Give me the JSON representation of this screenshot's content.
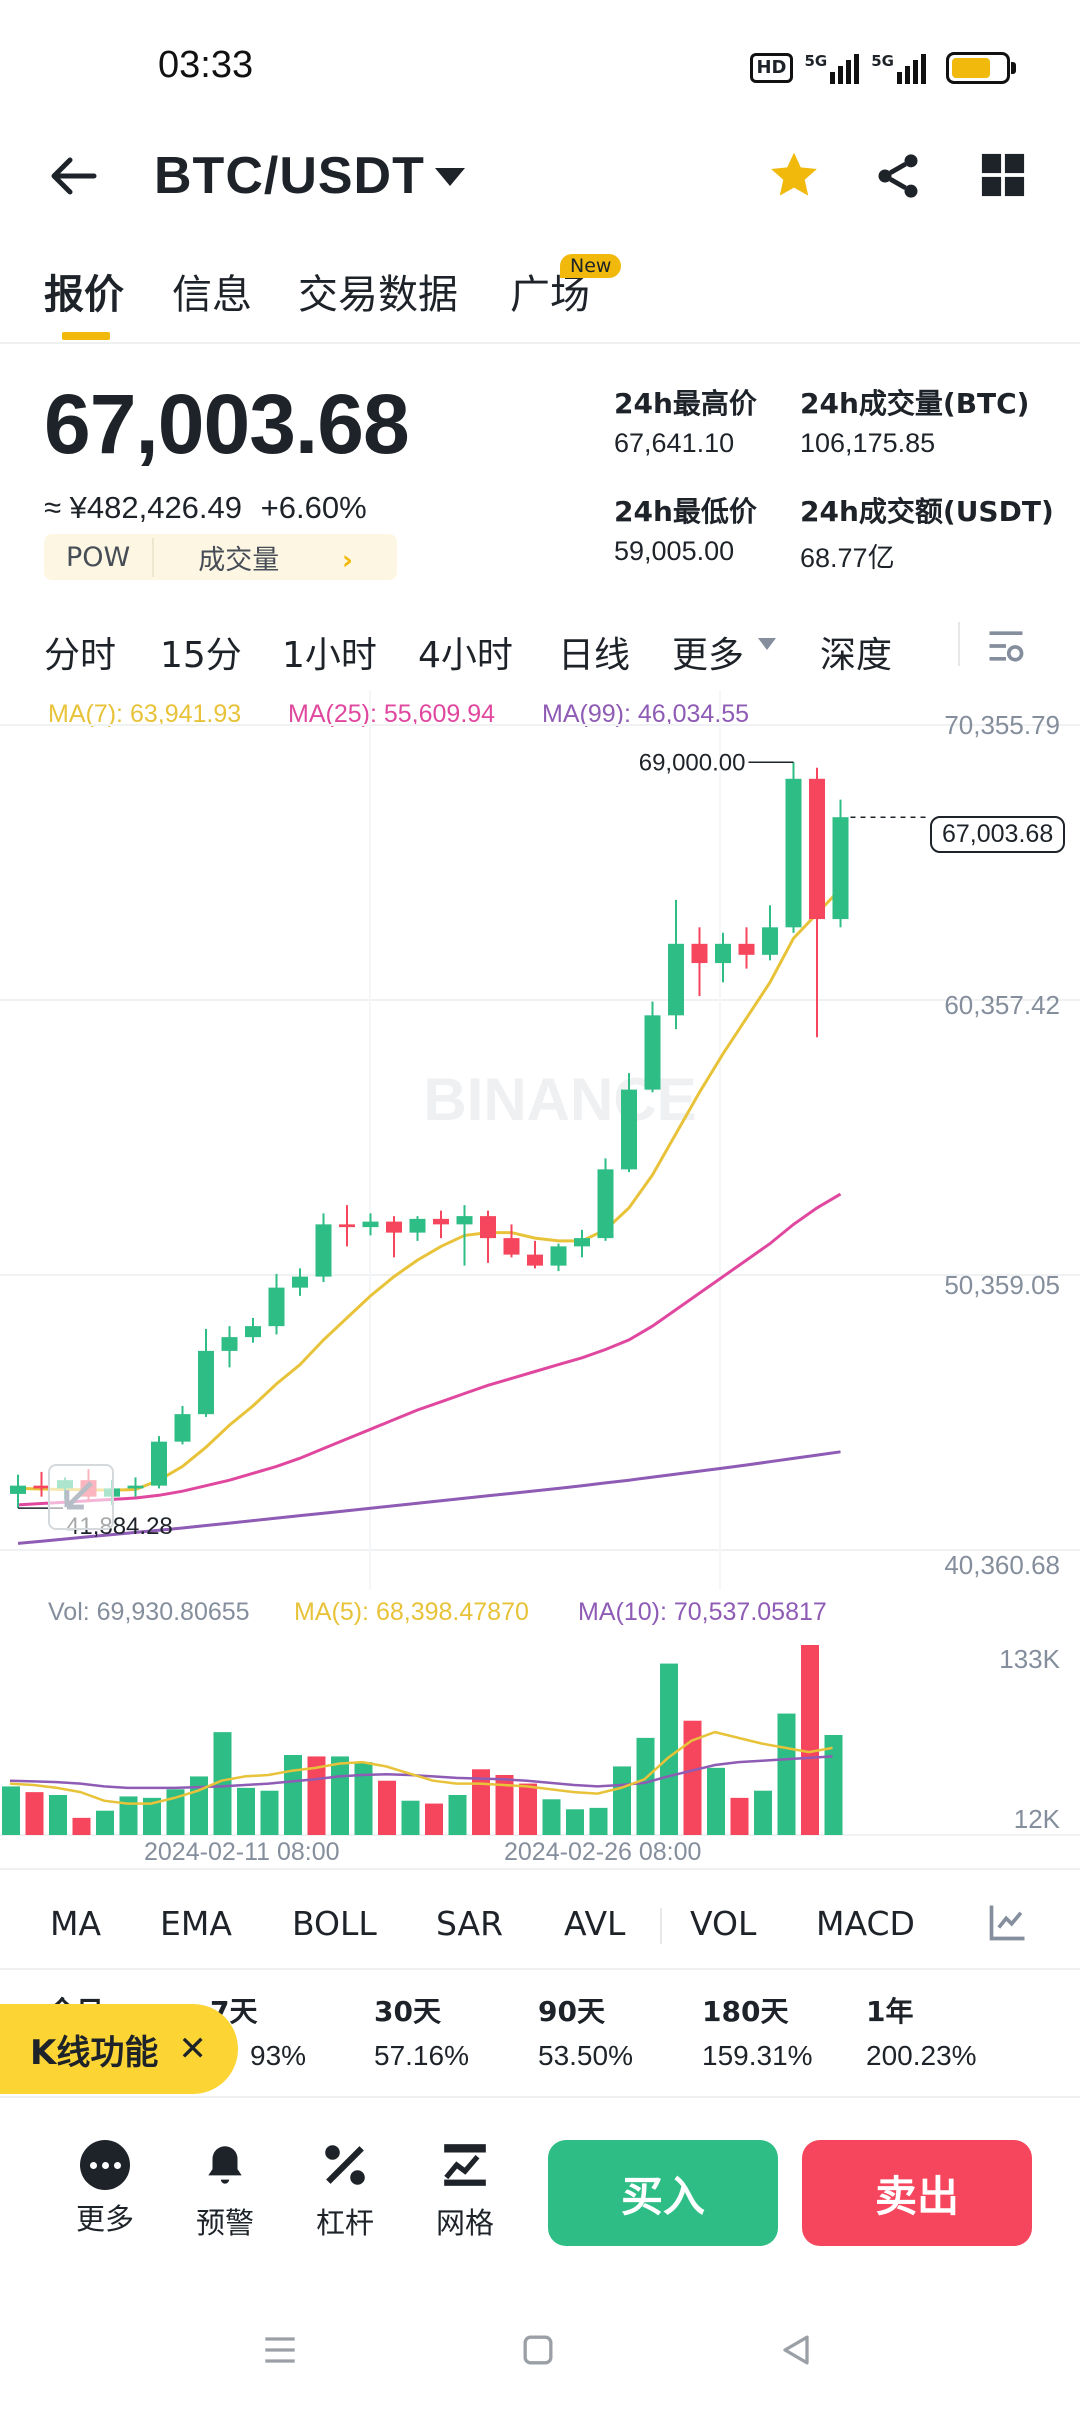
{
  "status": {
    "time": "03:33",
    "hd_label": "HD",
    "net1": "5G",
    "net2": "5G"
  },
  "header": {
    "pair": "BTC/USDT"
  },
  "tabs": [
    {
      "label": "报价"
    },
    {
      "label": "信息"
    },
    {
      "label": "交易数据"
    },
    {
      "label": "广场"
    }
  ],
  "new_badge": "New",
  "price": {
    "last": "67,003.68",
    "cny": "≈ ¥482,426.49",
    "change": "+6.60%",
    "tag": "POW",
    "volume_link": "成交量"
  },
  "stats": {
    "high_label": "24h最高价",
    "high": "67,641.10",
    "vol_btc_label": "24h成交量(BTC)",
    "vol_btc": "106,175.85",
    "low_label": "24h最低价",
    "low": "59,005.00",
    "vol_usdt_label": "24h成交额(USDT)",
    "vol_usdt": "68.77亿"
  },
  "intervals": [
    "分时",
    "15分",
    "1小时",
    "4小时",
    "日线",
    "更多",
    "深度"
  ],
  "chart": {
    "ma7": "MA(7): 63,941.93",
    "ma25": "MA(25): 55,609.94",
    "ma99": "MA(99): 46,034.55",
    "axis": [
      "70,355.79",
      "60,357.42",
      "50,359.05",
      "40,360.68"
    ],
    "high_mark": "69,000.00",
    "low_mark": "41,884.28",
    "last_tag": "67,003.68",
    "watermark": "BINANCE",
    "colors": {
      "up": "#2ebd85",
      "down": "#f6465d",
      "ma7": "#e8c33a",
      "ma25": "#e0489f",
      "ma99": "#8e5bb5"
    }
  },
  "chart_data": {
    "type": "candlestick",
    "ylim": [
      40360.68,
      70355.79
    ],
    "candles": [
      {
        "o": 42400,
        "h": 43100,
        "l": 41884.28,
        "c": 42700
      },
      {
        "o": 42700,
        "h": 43200,
        "l": 42300,
        "c": 42600
      },
      {
        "o": 42600,
        "h": 43000,
        "l": 42200,
        "c": 42900
      },
      {
        "o": 42900,
        "h": 43300,
        "l": 42100,
        "c": 42300
      },
      {
        "o": 42300,
        "h": 42900,
        "l": 42000,
        "c": 42600
      },
      {
        "o": 42600,
        "h": 43000,
        "l": 42300,
        "c": 42700
      },
      {
        "o": 42700,
        "h": 44500,
        "l": 42600,
        "c": 44300
      },
      {
        "o": 44300,
        "h": 45600,
        "l": 44200,
        "c": 45300
      },
      {
        "o": 45300,
        "h": 48400,
        "l": 45200,
        "c": 47600
      },
      {
        "o": 47600,
        "h": 48500,
        "l": 47000,
        "c": 48100
      },
      {
        "o": 48100,
        "h": 48800,
        "l": 47900,
        "c": 48500
      },
      {
        "o": 48500,
        "h": 50400,
        "l": 48200,
        "c": 49900
      },
      {
        "o": 49900,
        "h": 50600,
        "l": 49600,
        "c": 50300
      },
      {
        "o": 50300,
        "h": 52600,
        "l": 50100,
        "c": 52200
      },
      {
        "o": 52200,
        "h": 52900,
        "l": 51400,
        "c": 52100
      },
      {
        "o": 52100,
        "h": 52600,
        "l": 51800,
        "c": 52300
      },
      {
        "o": 52300,
        "h": 52500,
        "l": 51000,
        "c": 51900
      },
      {
        "o": 51900,
        "h": 52500,
        "l": 51600,
        "c": 52400
      },
      {
        "o": 52400,
        "h": 52700,
        "l": 51700,
        "c": 52200
      },
      {
        "o": 52200,
        "h": 52900,
        "l": 50700,
        "c": 52500
      },
      {
        "o": 52500,
        "h": 52700,
        "l": 50800,
        "c": 51700
      },
      {
        "o": 51700,
        "h": 52200,
        "l": 51000,
        "c": 51100
      },
      {
        "o": 51100,
        "h": 51600,
        "l": 50600,
        "c": 50700
      },
      {
        "o": 50700,
        "h": 51500,
        "l": 50500,
        "c": 51400
      },
      {
        "o": 51400,
        "h": 52000,
        "l": 51000,
        "c": 51700
      },
      {
        "o": 51700,
        "h": 54600,
        "l": 51600,
        "c": 54200
      },
      {
        "o": 54200,
        "h": 57700,
        "l": 54100,
        "c": 57100
      },
      {
        "o": 57100,
        "h": 60300,
        "l": 57000,
        "c": 59800
      },
      {
        "o": 59800,
        "h": 64000,
        "l": 59300,
        "c": 62400
      },
      {
        "o": 62400,
        "h": 63000,
        "l": 60500,
        "c": 61700
      },
      {
        "o": 61700,
        "h": 62800,
        "l": 61000,
        "c": 62400
      },
      {
        "o": 62400,
        "h": 63000,
        "l": 61500,
        "c": 62000
      },
      {
        "o": 62000,
        "h": 63800,
        "l": 61800,
        "c": 63000
      },
      {
        "o": 63000,
        "h": 69000,
        "l": 62800,
        "c": 68400
      },
      {
        "o": 68400,
        "h": 68800,
        "l": 59005,
        "c": 63300
      },
      {
        "o": 63300,
        "h": 67641.1,
        "l": 63000,
        "c": 67003.68
      }
    ],
    "ma7": [
      42600,
      42580,
      42560,
      42550,
      42540,
      42560,
      42900,
      43400,
      44100,
      44900,
      45600,
      46400,
      47100,
      48000,
      48800,
      49600,
      50300,
      50900,
      51400,
      51800,
      51900,
      51900,
      51700,
      51600,
      51600,
      52000,
      52800,
      54000,
      55500,
      57000,
      58400,
      59700,
      61000,
      62600,
      63500,
      64400
    ],
    "ma25": [
      42000,
      42050,
      42100,
      42150,
      42200,
      42250,
      42350,
      42500,
      42700,
      42900,
      43150,
      43400,
      43700,
      44050,
      44400,
      44750,
      45100,
      45450,
      45750,
      46050,
      46350,
      46600,
      46850,
      47100,
      47350,
      47650,
      48000,
      48500,
      49100,
      49700,
      50300,
      50900,
      51500,
      52200,
      52800,
      53300
    ],
    "ma99": [
      40600,
      40680,
      40760,
      40840,
      40920,
      41000,
      41080,
      41160,
      41250,
      41340,
      41430,
      41520,
      41610,
      41700,
      41790,
      41880,
      41970,
      42060,
      42150,
      42240,
      42330,
      42420,
      42510,
      42600,
      42700,
      42800,
      42900,
      43010,
      43120,
      43230,
      43340,
      43450,
      43570,
      43690,
      43810,
      43930
    ],
    "volume": {
      "ylim": [
        0,
        133000
      ],
      "labels": [
        "133K",
        "12K"
      ],
      "vol_label": "Vol: 69,930.80655",
      "ma5_label": "MA(5): 68,398.47870",
      "ma10_label": "MA(10): 70,537.05817",
      "values": [
        34000,
        30000,
        28000,
        12000,
        17000,
        27000,
        26000,
        32000,
        41000,
        72000,
        33000,
        31000,
        56000,
        55000,
        55000,
        51000,
        38000,
        24000,
        22000,
        28000,
        46000,
        42000,
        36000,
        25000,
        18000,
        19000,
        48000,
        68000,
        120000,
        80000,
        47000,
        26000,
        31000,
        85000,
        133000,
        70000
      ],
      "ma5": [
        36000,
        35000,
        33000,
        30000,
        24000,
        22000,
        22000,
        26000,
        31000,
        38000,
        41000,
        42000,
        45000,
        47000,
        50000,
        51000,
        48000,
        43000,
        38000,
        36000,
        36000,
        35000,
        34000,
        32000,
        30000,
        29000,
        33000,
        39000,
        54000,
        66000,
        72000,
        68000,
        64000,
        61000,
        58000,
        61000
      ],
      "ma10": [
        38000,
        37500,
        37000,
        36000,
        34000,
        33000,
        33000,
        33000,
        33500,
        34000,
        35000,
        36000,
        37500,
        39000,
        41000,
        42000,
        42500,
        42000,
        41000,
        40000,
        39500,
        39000,
        38000,
        36500,
        35000,
        34000,
        35000,
        36500,
        41000,
        45000,
        49000,
        51000,
        52000,
        53000,
        54000,
        55000
      ],
      "up": [
        true,
        false,
        true,
        false,
        true,
        true,
        true,
        true,
        true,
        true,
        true,
        true,
        true,
        false,
        true,
        true,
        false,
        true,
        false,
        true,
        false,
        false,
        false,
        true,
        true,
        true,
        true,
        true,
        true,
        false,
        true,
        false,
        true,
        true,
        false,
        true
      ]
    },
    "x_dates": [
      "2024-02-11 08:00",
      "2024-02-26 08:00"
    ]
  },
  "indicators": [
    "MA",
    "EMA",
    "BOLL",
    "SAR",
    "AVL",
    "VOL",
    "MACD"
  ],
  "periods": [
    {
      "label": "今日",
      "value": ""
    },
    {
      "label": "7天",
      "value": "93%"
    },
    {
      "label": "30天",
      "value": "57.16%"
    },
    {
      "label": "90天",
      "value": "53.50%"
    },
    {
      "label": "180天",
      "value": "159.31%"
    },
    {
      "label": "1年",
      "value": "200.23%"
    }
  ],
  "kline_label": "K线功能",
  "actions": [
    {
      "label": "更多"
    },
    {
      "label": "预警"
    },
    {
      "label": "杠杆"
    },
    {
      "label": "网格"
    }
  ],
  "buy_label": "买入",
  "sell_label": "卖出"
}
